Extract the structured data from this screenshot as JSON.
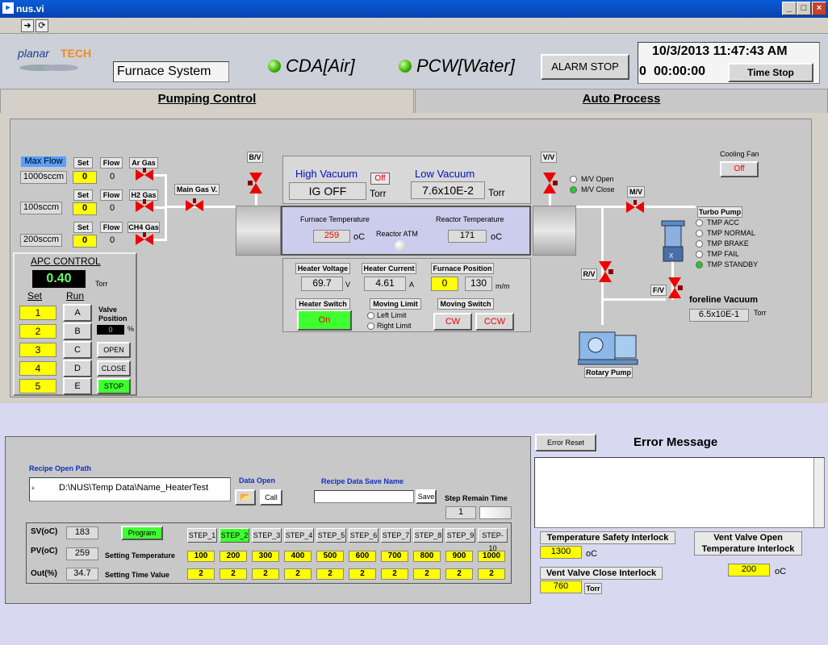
{
  "window": {
    "title": "nus.vi"
  },
  "header": {
    "system_name": "Furnace System",
    "cda": "CDA[Air]",
    "pcw": "PCW[Water]",
    "alarm_stop": "ALARM STOP",
    "datetime": "10/3/2013 11:47:43 AM",
    "elapsed_day": "0",
    "elapsed_time": "00:00:00",
    "time_stop": "Time Stop"
  },
  "tabs": [
    "Pumping Control",
    "Auto Process"
  ],
  "gas": {
    "max_flow_label": "Max Flow",
    "set_label": "Set",
    "flow_label": "Flow",
    "rows": [
      {
        "range": "1000sccm",
        "set": "0",
        "flow": "0",
        "gas": "Ar Gas"
      },
      {
        "range": "100sccm",
        "set": "0",
        "flow": "0",
        "gas": "H2 Gas"
      },
      {
        "range": "200sccm",
        "set": "0",
        "flow": "0",
        "gas": "CH4 Gas"
      }
    ],
    "main_gas": "Main Gas V."
  },
  "apc": {
    "title": "APC CONTROL",
    "value": "0.40",
    "unit": "Torr",
    "set_label": "Set",
    "run_label": "Run",
    "sets": [
      "1",
      "2",
      "3",
      "4",
      "5"
    ],
    "runs": [
      "A",
      "B",
      "C",
      "D",
      "E"
    ],
    "valve_position_label": "Valve Position",
    "valve_position": "0",
    "valve_unit": "%",
    "open": "OPEN",
    "close": "CLOSE",
    "stop": "STOP"
  },
  "vacuum": {
    "bv": "B/V",
    "vv": "V/V",
    "mv": "M/V",
    "rv": "R/V",
    "fv": "F/V",
    "high_label": "High Vacuum",
    "high_state": "Off",
    "high_value": "IG OFF",
    "high_unit": "Torr",
    "low_label": "Low Vacuum",
    "low_value": "7.6x10E-2",
    "low_unit": "Torr",
    "mv_open": "M/V Open",
    "mv_close": "M/V Close"
  },
  "furnace": {
    "furnace_temp_label": "Furnace Temperature",
    "furnace_temp": "259",
    "temp_unit": "oC",
    "reactor_temp_label": "Reactor Temperature",
    "reactor_temp": "171",
    "reactor_atm": "Reactor ATM"
  },
  "heater": {
    "voltage_label": "Heater Voltage",
    "voltage": "69.7",
    "voltage_unit": "V",
    "current_label": "Heater Current",
    "current": "4.61",
    "current_unit": "A",
    "position_label": "Furnace Position",
    "position_set": "0",
    "position_val": "130",
    "position_unit": "m/m",
    "switch_label": "Heater Switch",
    "switch_state": "On",
    "moving_limit_label": "Moving Limit",
    "left_limit": "Left Limit",
    "right_limit": "Right Limit",
    "moving_switch_label": "Moving Switch",
    "cw": "CW",
    "ccw": "CCW"
  },
  "cooling": {
    "label": "Cooling Fan",
    "state": "Off"
  },
  "turbo": {
    "label": "Turbo Pump",
    "states": [
      "TMP ACC",
      "TMP NORMAL",
      "TMP BRAKE",
      "TMP FAIL",
      "TMP STANDBY"
    ],
    "foreline_label": "foreline Vacuum",
    "foreline_value": "6.5x10E-1",
    "foreline_unit": "Torr",
    "rotary": "Rotary Pump"
  },
  "recipe": {
    "open_path_label": "Recipe Open Path",
    "path": "D:\\NUS\\Temp Data\\Name_HeaterTest",
    "data_open": "Data Open",
    "call": "Call",
    "save_name_label": "Recipe Data Save Name",
    "save": "Save",
    "step_remain_label": "Step Remain Time",
    "step_remain": "1",
    "sv_label": "SV(oC)",
    "sv": "183",
    "pv_label": "PV(oC)",
    "pv": "259",
    "out_label": "Out(%)",
    "out": "34.7",
    "program": "Program",
    "setting_temp_label": "Setting Temperature",
    "setting_time_label": "Setting Time Value",
    "steps": [
      "STEP_1",
      "STEP_2",
      "STEP_3",
      "STEP_4",
      "STEP_5",
      "STEP_6",
      "STEP_7",
      "STEP_8",
      "STEP_9",
      "STEP-10"
    ],
    "temps": [
      "100",
      "200",
      "300",
      "400",
      "500",
      "600",
      "700",
      "800",
      "900",
      "1000"
    ],
    "times": [
      "2",
      "2",
      "2",
      "2",
      "2",
      "2",
      "2",
      "2",
      "2",
      "2"
    ]
  },
  "errors": {
    "reset": "Error Reset",
    "title": "Error Message",
    "temp_safety_label": "Temperature Safety Interlock",
    "temp_safety": "1300",
    "vent_close_label": "Vent Valve Close Interlock",
    "vent_close": "760",
    "vent_close_unit": "Torr",
    "vent_open_label": "Vent Valve Open Temperature Interlock",
    "vent_open": "200",
    "unit_c": "oC"
  }
}
